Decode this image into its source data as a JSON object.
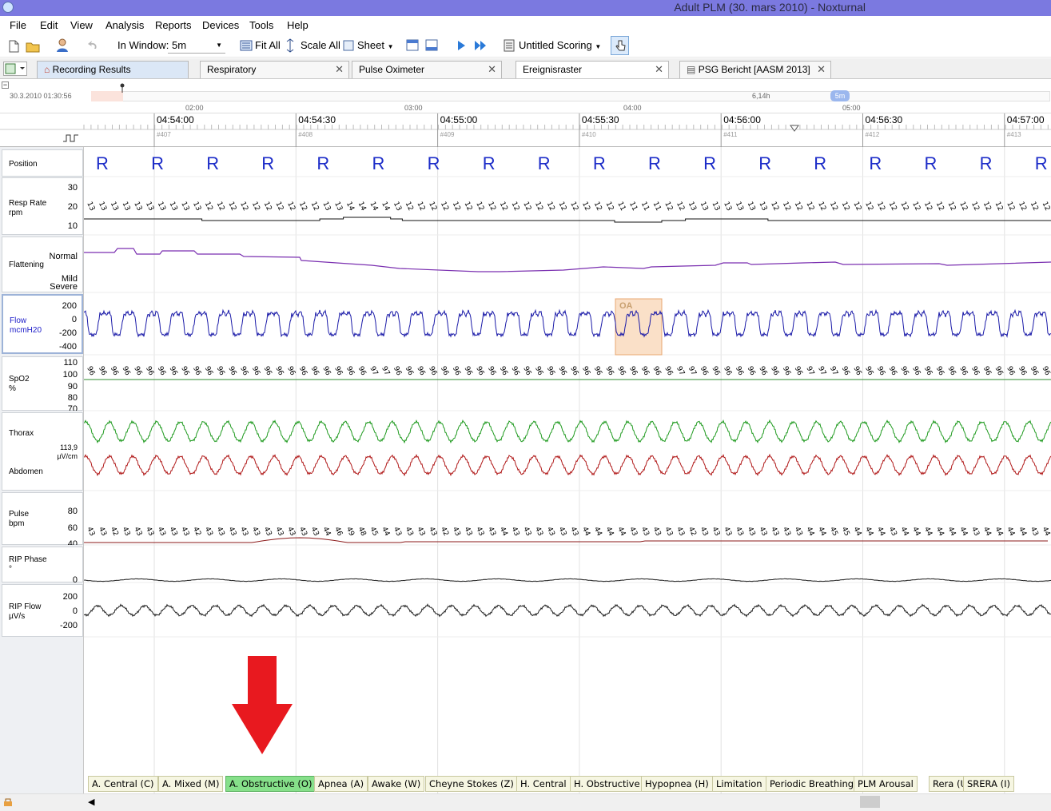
{
  "window": {
    "title": "Adult PLM (30. mars 2010)  - Noxturnal"
  },
  "menu": [
    "File",
    "Edit",
    "View",
    "Analysis",
    "Reports",
    "Devices",
    "Tools",
    "Help"
  ],
  "toolbar": {
    "in_window_label": "In Window:",
    "in_window_value": "5m",
    "fit_all": "Fit All",
    "scale_all": "Scale All",
    "sheet": "Sheet",
    "scoring": "Untitled Scoring"
  },
  "tabs": [
    {
      "label": "Recording Results",
      "active": true
    },
    {
      "label": "Respiratory",
      "active": false
    },
    {
      "label": "Pulse Oximeter",
      "active": false
    },
    {
      "label": "Ereignisraster",
      "active": false
    },
    {
      "label": "PSG Bericht [AASM 2013]",
      "active": false
    }
  ],
  "overview": {
    "start": "30.3.2010 01:30:56",
    "ticks": [
      "02:00",
      "03:00",
      "04:00",
      "05:00"
    ],
    "duration": "6,14h",
    "window_badge": "5m"
  },
  "timeline": {
    "times": [
      "04:54:00",
      "04:54:30",
      "04:55:00",
      "04:55:30",
      "04:56:00",
      "04:56:30",
      "04:57:00"
    ],
    "epochs": [
      "#407",
      "#408",
      "#409",
      "#410",
      "#411",
      "#412",
      "#413"
    ]
  },
  "channels": {
    "position": {
      "name": "Position",
      "value": "R"
    },
    "resp_rate": {
      "name": "Resp Rate",
      "unit": "rpm",
      "scale": [
        "30",
        "20",
        "10"
      ],
      "values": [
        "13",
        "13",
        "13",
        "13",
        "13",
        "13",
        "13",
        "13",
        "13",
        "13",
        "12",
        "12",
        "12",
        "12",
        "12",
        "12",
        "12",
        "12",
        "12",
        "12",
        "13",
        "13",
        "14",
        "14",
        "14",
        "14",
        "13",
        "12",
        "12",
        "12",
        "12",
        "12",
        "12",
        "12",
        "12",
        "12",
        "12",
        "12",
        "12",
        "12",
        "12",
        "12",
        "12",
        "12",
        "12",
        "11",
        "11",
        "11",
        "11",
        "12",
        "12",
        "13",
        "13",
        "13",
        "13",
        "13",
        "13",
        "13",
        "12",
        "12",
        "12",
        "12",
        "12",
        "12",
        "12",
        "12",
        "12",
        "12",
        "12",
        "12",
        "12",
        "12",
        "12",
        "12",
        "12",
        "12",
        "12",
        "12",
        "12",
        "12",
        "12",
        "12"
      ]
    },
    "flattening": {
      "name": "Flattening",
      "scale": [
        "Normal",
        "Mild",
        "Severe"
      ]
    },
    "flow": {
      "name": "Flow",
      "unit": "mcmH20",
      "scale": [
        "200",
        "0",
        "-200",
        "-400"
      ],
      "event": "OA"
    },
    "spo2": {
      "name": "SpO2",
      "unit": "%",
      "scale": [
        "110",
        "100",
        "90",
        "80",
        "70"
      ],
      "values": [
        "96",
        "96",
        "96",
        "96",
        "96",
        "96",
        "96",
        "96",
        "96",
        "96",
        "96",
        "96",
        "96",
        "96",
        "96",
        "96",
        "96",
        "96",
        "96",
        "96",
        "96",
        "96",
        "96",
        "96",
        "97",
        "97",
        "96",
        "96",
        "96",
        "96",
        "96",
        "96",
        "96",
        "96",
        "96",
        "96",
        "96",
        "96",
        "96",
        "96",
        "96",
        "96",
        "96",
        "96",
        "96",
        "96",
        "96",
        "96",
        "96",
        "96",
        "97",
        "97",
        "96",
        "96",
        "96",
        "96",
        "96",
        "96",
        "96",
        "96",
        "96",
        "97",
        "97",
        "97",
        "96",
        "96",
        "96",
        "96",
        "96",
        "96",
        "96",
        "96",
        "96",
        "96",
        "96",
        "96",
        "96",
        "96",
        "96",
        "96",
        "96",
        "96"
      ]
    },
    "thorax": {
      "name": "Thorax",
      "scale_value": "113,9",
      "scale_unit": "µV/cm"
    },
    "abdomen": {
      "name": "Abdomen"
    },
    "pulse": {
      "name": "Pulse",
      "unit": "bpm",
      "scale": [
        "80",
        "60",
        "40"
      ],
      "values": [
        "43",
        "43",
        "42",
        "43",
        "43",
        "43",
        "43",
        "43",
        "43",
        "42",
        "43",
        "43",
        "43",
        "43",
        "43",
        "43",
        "43",
        "43",
        "43",
        "43",
        "44",
        "46",
        "49",
        "48",
        "45",
        "44",
        "43",
        "43",
        "43",
        "43",
        "42",
        "43",
        "43",
        "43",
        "43",
        "44",
        "43",
        "43",
        "43",
        "43",
        "43",
        "43",
        "44",
        "44",
        "44",
        "44",
        "43",
        "43",
        "43",
        "43",
        "43",
        "42",
        "43",
        "43",
        "43",
        "43",
        "43",
        "43",
        "43",
        "43",
        "43",
        "44",
        "44",
        "45",
        "45",
        "44",
        "44",
        "44",
        "43",
        "44",
        "44",
        "44",
        "44",
        "44",
        "44",
        "43",
        "44",
        "44",
        "44",
        "44",
        "43",
        "44"
      ]
    },
    "rip_phase": {
      "name": "RIP Phase",
      "unit": "°",
      "scale": [
        "0"
      ]
    },
    "rip_flow": {
      "name": "RIP Flow",
      "unit": "µV/s",
      "scale": [
        "200",
        "0",
        "-200"
      ]
    }
  },
  "event_types": [
    {
      "label": "A. Central (C)",
      "active": false
    },
    {
      "label": "A. Mixed (M)",
      "active": false
    },
    {
      "label": "A. Obstructive (O)",
      "active": true
    },
    {
      "label": "Apnea (A)",
      "active": false
    },
    {
      "label": "Awake (W)",
      "active": false
    },
    {
      "label": "Cheyne Stokes (Z)",
      "active": false
    },
    {
      "label": "H. Central",
      "active": false
    },
    {
      "label": "H. Obstructive",
      "active": false
    },
    {
      "label": "Hypopnea (H)",
      "active": false
    },
    {
      "label": "Limitation",
      "active": false
    },
    {
      "label": "Periodic Breathing",
      "active": false
    },
    {
      "label": "PLM Arousal",
      "active": false
    },
    {
      "label": "Rera (U)",
      "active": false
    },
    {
      "label": "SRERA (I)",
      "active": false
    }
  ],
  "colors": {
    "flow": "#1a1aa8",
    "thorax": "#1f9a1f",
    "abdomen": "#b01818",
    "flattening": "#7a2fb0",
    "spo2_line": "#2e8b2e",
    "pulse_line": "#8b1a1a",
    "position": "#1c2cc8",
    "event_box": "#f6c79a",
    "arrow": "#e8191f"
  }
}
